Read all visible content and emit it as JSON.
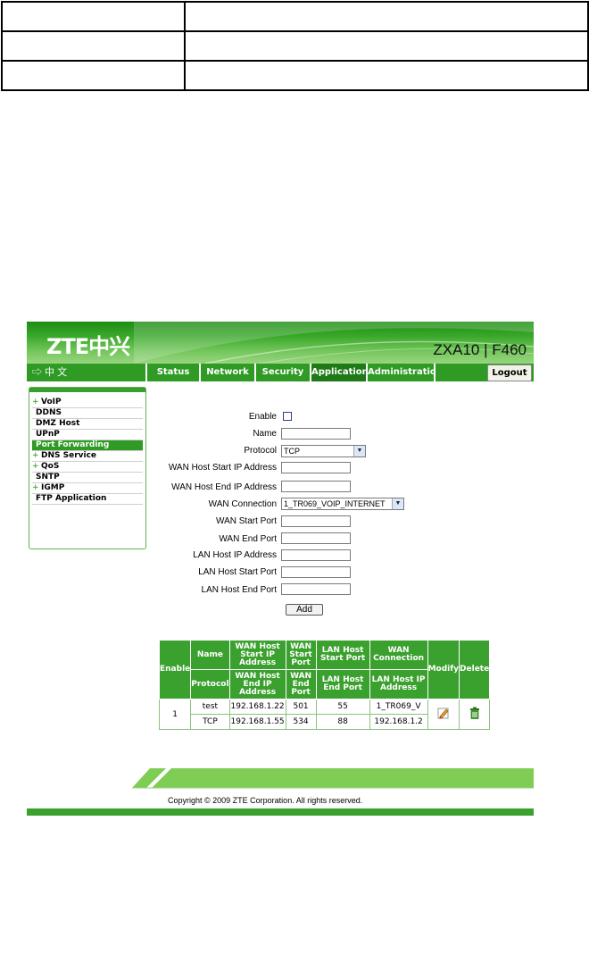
{
  "app": {
    "logo": "ZTE中兴",
    "model": "ZXA10 | F460",
    "language": "⇨ 中 文",
    "tabs": [
      "Status",
      "Network",
      "Security",
      "Application",
      "Administration"
    ],
    "active_tab": "Application",
    "logout": "Logout"
  },
  "sidebar": {
    "items": [
      {
        "label": "VoIP",
        "section": true
      },
      {
        "label": "DDNS",
        "section": false
      },
      {
        "label": "DMZ Host",
        "section": false
      },
      {
        "label": "UPnP",
        "section": false
      },
      {
        "label": "Port Forwarding",
        "section": false,
        "selected": true
      },
      {
        "label": "DNS Service",
        "section": true
      },
      {
        "label": "QoS",
        "section": true
      },
      {
        "label": "SNTP",
        "section": false
      },
      {
        "label": "IGMP",
        "section": true
      },
      {
        "label": "FTP Application",
        "section": false
      }
    ]
  },
  "form": {
    "enable_label": "Enable",
    "name_label": "Name",
    "protocol_label": "Protocol",
    "protocol_value": "TCP",
    "wan_start_ip_label": "WAN Host Start IP Address",
    "wan_end_ip_label": "WAN Host End IP Address",
    "wan_connection_label": "WAN Connection",
    "wan_connection_value": "1_TR069_VOIP_INTERNET",
    "wan_start_port_label": "WAN Start Port",
    "wan_end_port_label": "WAN End Port",
    "lan_ip_label": "LAN Host IP Address",
    "lan_start_port_label": "LAN Host Start Port",
    "lan_end_port_label": "LAN Host End Port",
    "add_button": "Add"
  },
  "table": {
    "headers": {
      "enable": "Enable",
      "name": "Name",
      "protocol": "Protocol",
      "wan_start_ip": "WAN Host Start IP Address",
      "wan_end_ip": "WAN Host End IP Address",
      "wan_start_port": "WAN Start Port",
      "wan_end_port": "WAN End Port",
      "lan_start_port": "LAN Host Start Port",
      "lan_end_port": "LAN Host End Port",
      "wan_connection": "WAN Connection",
      "lan_ip": "LAN Host IP Address",
      "modify": "Modify",
      "delete": "Delete"
    },
    "row": {
      "enable": "1",
      "name": "test",
      "protocol": "TCP",
      "wan_start_ip": "192.168.1.22",
      "wan_end_ip": "192.168.1.55",
      "wan_start_port": "501",
      "wan_end_port": "534",
      "lan_start_port": "55",
      "lan_end_port": "88",
      "wan_connection": "1_TR069_V",
      "lan_ip": "192.168.1.2"
    }
  },
  "footer": {
    "copyright": "Copyright © 2009 ZTE Corporation. All rights reserved."
  },
  "colors": {
    "brand_green": "#2f9a24",
    "active_tab": "#1e7a17"
  }
}
